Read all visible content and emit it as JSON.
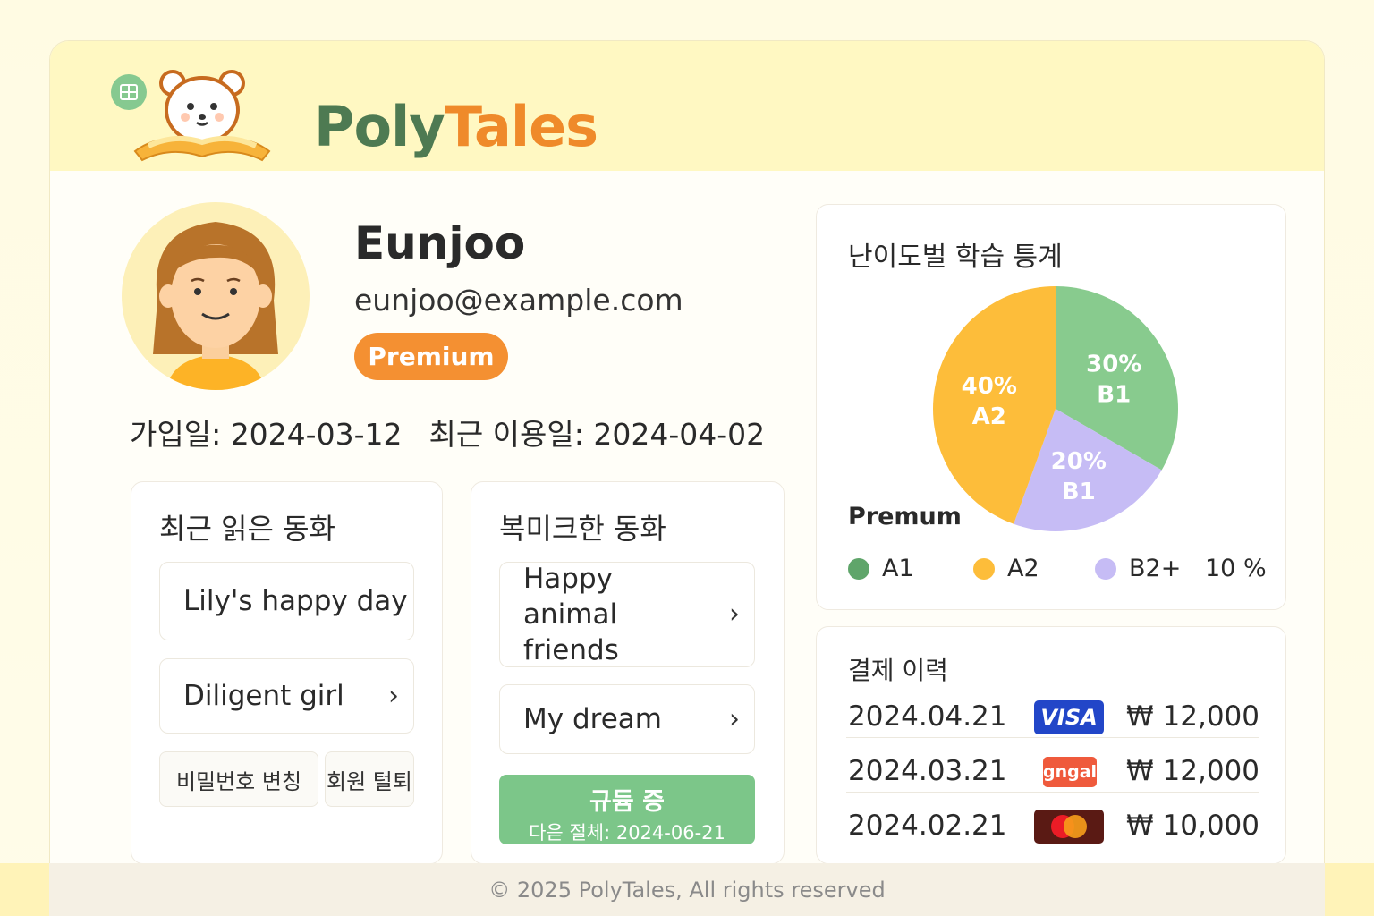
{
  "brand": {
    "name_part1": "Poly",
    "name_part2": "Tales"
  },
  "profile": {
    "name": "Eunjoo",
    "email": "eunjoo@example.com",
    "plan_badge": "Premium",
    "joined_label": "가입일: 2024-03-12",
    "last_used_label": "최근 이용일: 2024-04-02"
  },
  "recent_stories": {
    "title": "최근 읽은 동화",
    "items": [
      "Lily's happy day",
      "Diligent girl"
    ]
  },
  "account_actions": {
    "change_password": "비밀번호 변칭",
    "withdraw": "회원 털퇴"
  },
  "bookmarks": {
    "title": "복미크한 동화",
    "items": [
      "Happy animal friends",
      "My dream"
    ]
  },
  "subscription": {
    "status": "규듐 증",
    "next_billing": "다읃 절체: 2024-06-21"
  },
  "stats": {
    "title": "난이도벌 학습 틍계",
    "premium_label": "Premum",
    "extra_legend_value": "10 %",
    "colors": {
      "A1": "#5fa56a",
      "A2": "#fdbd3a",
      "B1": "#88cb8e",
      "B2": "#c6bcf5"
    }
  },
  "chart_data": {
    "type": "pie",
    "slices": [
      {
        "percent_label": "30%",
        "level": "B1",
        "value": 30,
        "color": "#88cb8e"
      },
      {
        "percent_label": "20%",
        "level": "B1",
        "value": 20,
        "color": "#c6bcf5"
      },
      {
        "percent_label": "40%",
        "level": "A2",
        "value": 40,
        "color": "#fdbd3a"
      }
    ],
    "legend": [
      {
        "label": "A1",
        "color": "#5fa56a"
      },
      {
        "label": "A2",
        "color": "#fdbd3a"
      },
      {
        "label": "B2+",
        "color": "#c6bcf5"
      }
    ]
  },
  "payments": {
    "title": "결제 이력",
    "rows": [
      {
        "date": "2024.04.21",
        "method": "VISA",
        "amount": "₩ 12,000"
      },
      {
        "date": "2024.03.21",
        "method": "gngal",
        "amount": "₩ 12,000"
      },
      {
        "date": "2024.02.21",
        "method": "mastercard",
        "amount": "₩ 10,000"
      }
    ]
  },
  "footer": {
    "text": "© 2025 PolyTales, All rights reserved"
  }
}
